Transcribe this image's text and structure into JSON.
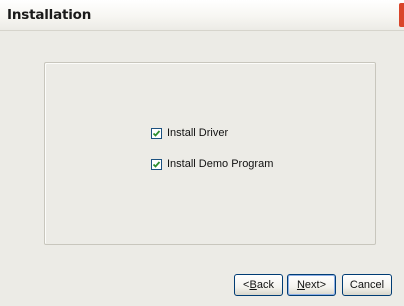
{
  "window": {
    "title": "Installation"
  },
  "options": [
    {
      "label": "Install Driver",
      "checked": true
    },
    {
      "label": "Install Demo Program",
      "checked": true
    }
  ],
  "buttons": {
    "back": {
      "mnemonic": "B",
      "rest": "ack",
      "prefix": "<",
      "default": false
    },
    "next": {
      "mnemonic": "N",
      "rest": "ext>",
      "default": true
    },
    "cancel": {
      "label": "Cancel",
      "default": false
    }
  },
  "colors": {
    "title_accent": "#d9452a",
    "checkmark": "#2f8f2f",
    "button_border": "#003c74",
    "dialog_bg": "#ecebe6"
  }
}
